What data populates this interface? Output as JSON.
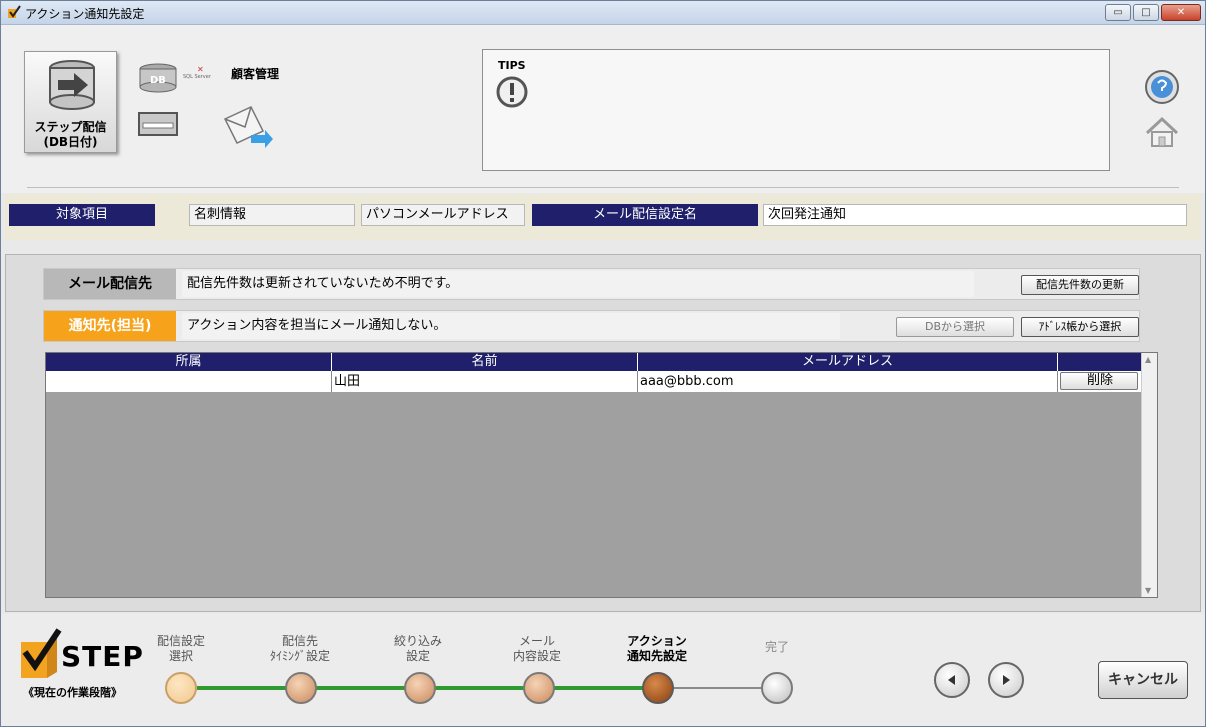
{
  "window": {
    "title": "アクション通知先設定",
    "buttons": {
      "minimize": "▭",
      "maximize": "□",
      "close": "✕"
    }
  },
  "header": {
    "big_button_label_1": "ステップ配信",
    "big_button_label_2": "(DB日付)",
    "crm_label": "顧客管理",
    "db_icon_text": "DB",
    "sql_text": "SQL Server",
    "tips_title": "TIPS"
  },
  "infobar": {
    "label_target": "対象項目",
    "value_card": "名刺情報",
    "value_mail_type": "パソコンメールアドレス",
    "label_setting": "メール配信設定名",
    "value_setting": "次回発注通知"
  },
  "delivery": {
    "tag": "メール配信先",
    "text": "配信先件数は更新されていないため不明です。",
    "update_button": "配信先件数の更新"
  },
  "notify": {
    "tag": "通知先(担当)",
    "text": "アクション内容を担当にメール通知しない。",
    "db_select_button": "DBから選択",
    "address_select_button": "ｱﾄﾞﾚｽ帳から選択"
  },
  "grid": {
    "columns": [
      "所属",
      "名前",
      "メールアドレス",
      ""
    ],
    "rows": [
      {
        "affiliation": "",
        "name": "山田",
        "email": "aaa@bbb.com",
        "action": "削除"
      }
    ]
  },
  "steps": {
    "logo_word": "STEP",
    "logo_sub": "《現在の作業段階》",
    "items": [
      {
        "line1": "配信設定",
        "line2": "選択",
        "state": "done"
      },
      {
        "line1": "配信先",
        "line2": "ﾀｲﾐﾝｸﾞ設定",
        "state": "done"
      },
      {
        "line1": "絞り込み",
        "line2": "設定",
        "state": "done"
      },
      {
        "line1": "メール",
        "line2": "内容設定",
        "state": "done"
      },
      {
        "line1": "アクション",
        "line2": "通知先設定",
        "state": "current"
      },
      {
        "line1": "完了",
        "line2": "",
        "state": "todo"
      }
    ],
    "cancel": "キャンセル"
  },
  "colors": {
    "navy": "#1f1f6b",
    "orange_tag": "#f7a21b",
    "progress_green": "#2f9a2f",
    "current_dot": "#a0521b"
  }
}
